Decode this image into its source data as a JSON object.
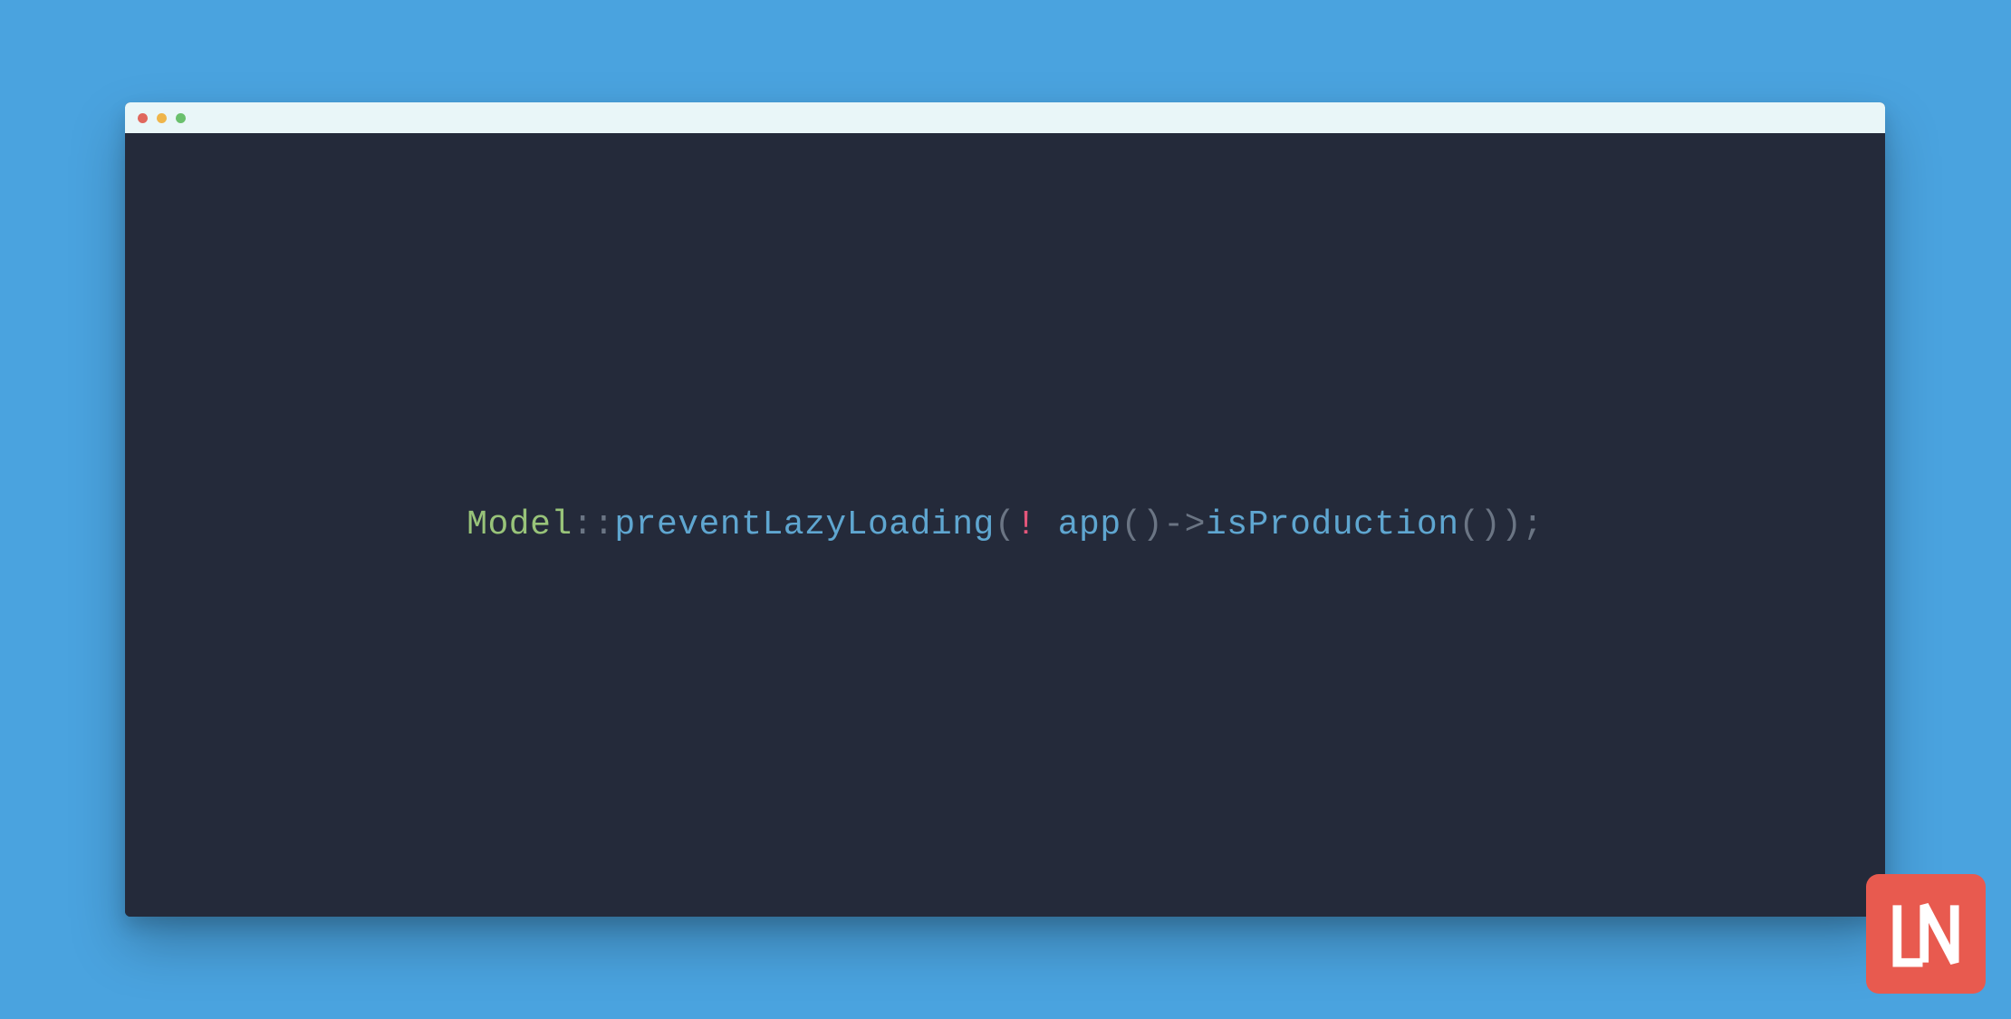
{
  "colors": {
    "page_bg": "#4aa3df",
    "window_bg": "#242a3a",
    "titlebar_bg": "#e9f6f8",
    "dot_red": "#e0675d",
    "dot_yellow": "#efb54a",
    "dot_green": "#6ac06d",
    "logo_bg": "#e85a4f",
    "token_class": "#98c379",
    "token_method": "#5fa6d0",
    "token_punct": "#6b7584",
    "token_bang": "#e4567b"
  },
  "code": {
    "tokens": [
      {
        "t": "Model",
        "cls": "class"
      },
      {
        "t": "::",
        "cls": "operator"
      },
      {
        "t": "preventLazyLoading",
        "cls": "method"
      },
      {
        "t": "(",
        "cls": "punct"
      },
      {
        "t": "!",
        "cls": "bang"
      },
      {
        "t": " ",
        "cls": ""
      },
      {
        "t": "app",
        "cls": "func"
      },
      {
        "t": "()",
        "cls": "punct"
      },
      {
        "t": "->",
        "cls": "operator"
      },
      {
        "t": "isProduction",
        "cls": "func"
      },
      {
        "t": "())",
        "cls": "punct"
      },
      {
        "t": ";",
        "cls": "punct"
      }
    ],
    "plain": "Model::preventLazyLoading(! app()->isProduction());"
  },
  "logo": {
    "text": "LN"
  }
}
